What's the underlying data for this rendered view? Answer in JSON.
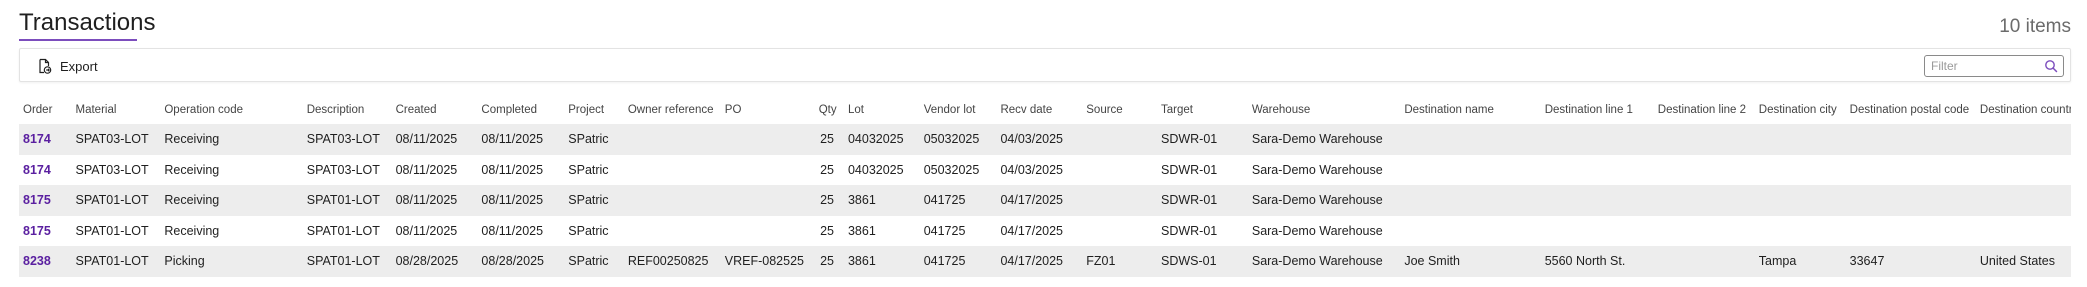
{
  "header": {
    "title": "Transactions",
    "items_count": "10 items",
    "accent_color": "#7c4dbd"
  },
  "toolbar": {
    "export_label": "Export",
    "export_icon": "export-document-icon",
    "filter_placeholder": "Filter",
    "filter_value": "",
    "filter_icon": "search-icon"
  },
  "table": {
    "columns": [
      "Order",
      "Material",
      "Operation code",
      "Description",
      "Created",
      "Completed",
      "Project",
      "Owner reference",
      "PO",
      "Qty",
      "Lot",
      "Vendor lot",
      "Recv date",
      "Source",
      "Target",
      "Warehouse",
      "Destination name",
      "Destination line 1",
      "Destination line 2",
      "Destination city",
      "Destination postal code",
      "Destination country"
    ],
    "rows": [
      [
        "8174",
        "SPAT03-LOT",
        "Receiving",
        "SPAT03-LOT",
        "08/11/2025",
        "08/11/2025",
        "SPatric",
        "",
        "",
        "25",
        "04032025",
        "05032025",
        "04/03/2025",
        "",
        "SDWR-01",
        "Sara-Demo Warehouse",
        "",
        "",
        "",
        "",
        "",
        ""
      ],
      [
        "8174",
        "SPAT03-LOT",
        "Receiving",
        "SPAT03-LOT",
        "08/11/2025",
        "08/11/2025",
        "SPatric",
        "",
        "",
        "25",
        "04032025",
        "05032025",
        "04/03/2025",
        "",
        "SDWR-01",
        "Sara-Demo Warehouse",
        "",
        "",
        "",
        "",
        "",
        ""
      ],
      [
        "8175",
        "SPAT01-LOT",
        "Receiving",
        "SPAT01-LOT",
        "08/11/2025",
        "08/11/2025",
        "SPatric",
        "",
        "",
        "25",
        "3861",
        "041725",
        "04/17/2025",
        "",
        "SDWR-01",
        "Sara-Demo Warehouse",
        "",
        "",
        "",
        "",
        "",
        ""
      ],
      [
        "8175",
        "SPAT01-LOT",
        "Receiving",
        "SPAT01-LOT",
        "08/11/2025",
        "08/11/2025",
        "SPatric",
        "",
        "",
        "25",
        "3861",
        "041725",
        "04/17/2025",
        "",
        "SDWR-01",
        "Sara-Demo Warehouse",
        "",
        "",
        "",
        "",
        "",
        ""
      ],
      [
        "8238",
        "SPAT01-LOT",
        "Picking",
        "SPAT01-LOT",
        "08/28/2025",
        "08/28/2025",
        "SPatric",
        "REF00250825",
        "VREF-082525",
        "25",
        "3861",
        "041725",
        "04/17/2025",
        "FZ01",
        "SDWS-01",
        "Sara-Demo Warehouse",
        "Joe Smith",
        "5560 North St.",
        "",
        "Tampa",
        "33647",
        "United States"
      ]
    ]
  }
}
